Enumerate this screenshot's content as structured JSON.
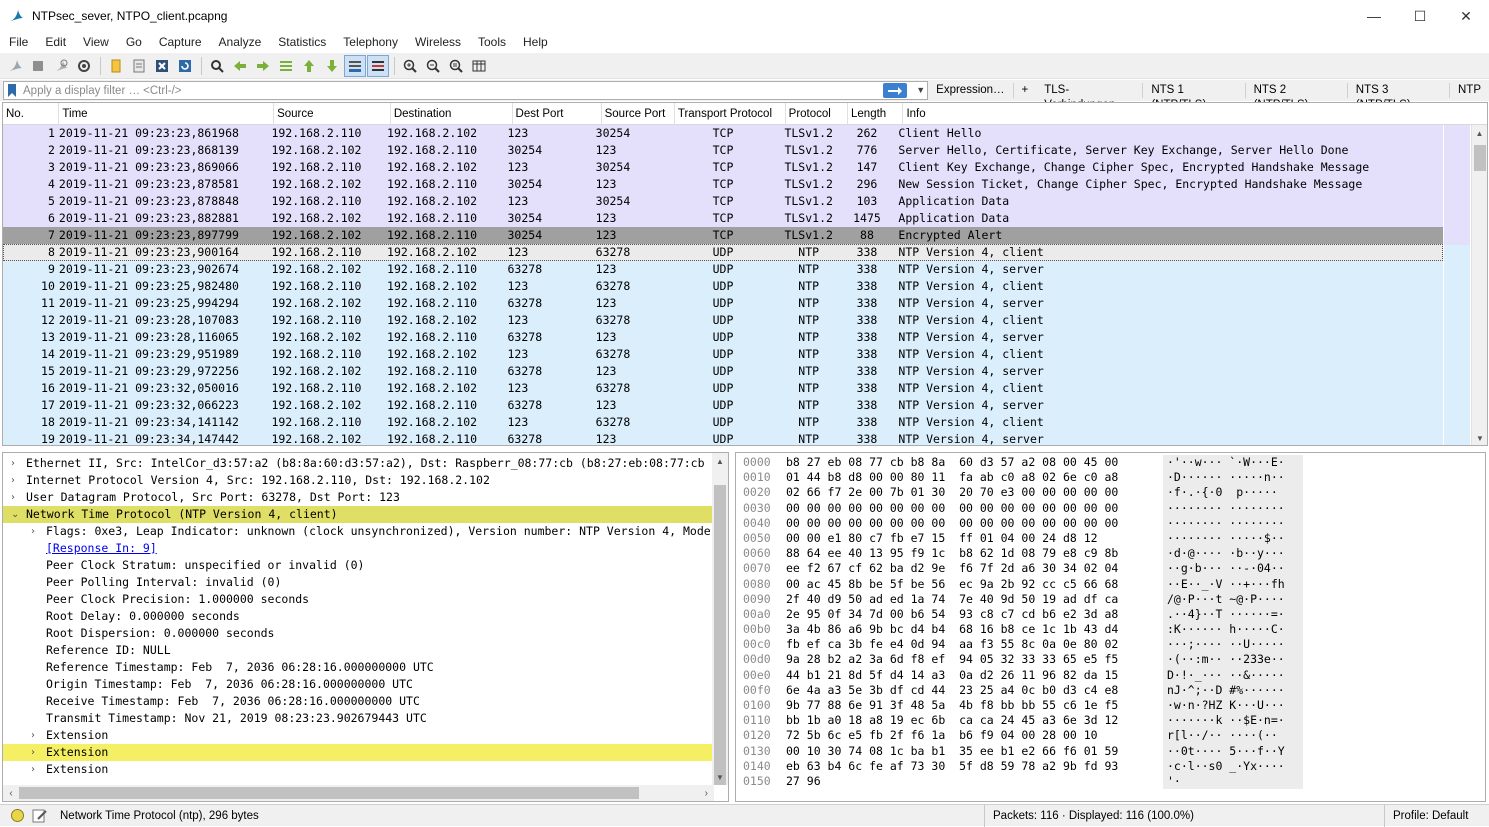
{
  "window": {
    "title": "NTPsec_sever, NTPO_client.pcapng"
  },
  "menu": [
    "File",
    "Edit",
    "View",
    "Go",
    "Capture",
    "Analyze",
    "Statistics",
    "Telephony",
    "Wireless",
    "Tools",
    "Help"
  ],
  "filter": {
    "placeholder": "Apply a display filter … <Ctrl-/>",
    "buttons": [
      "Expression…",
      "+",
      "TLS-Verbindungen",
      "NTS 1 (NTP/TLS)",
      "NTS 2 (NTP/TLS)",
      "NTS 3 (NTP/TLS)",
      "NTP"
    ]
  },
  "columns": [
    "No.",
    "Time",
    "Source",
    "Destination",
    "Dest Port",
    "Source Port",
    "Transport Protocol",
    "Protocol",
    "Length",
    "Info"
  ],
  "packets": [
    {
      "no": "1",
      "time": "2019-11-21 09:23:23,861968",
      "src": "192.168.2.110",
      "dst": "192.168.2.102",
      "dport": "123",
      "sport": "30254",
      "tp": "TCP",
      "proto": "TLSv1.2",
      "len": "262",
      "info": "Client Hello",
      "kind": "tls"
    },
    {
      "no": "2",
      "time": "2019-11-21 09:23:23,868139",
      "src": "192.168.2.102",
      "dst": "192.168.2.110",
      "dport": "30254",
      "sport": "123",
      "tp": "TCP",
      "proto": "TLSv1.2",
      "len": "776",
      "info": "Server Hello, Certificate, Server Key Exchange, Server Hello Done",
      "kind": "tls"
    },
    {
      "no": "3",
      "time": "2019-11-21 09:23:23,869066",
      "src": "192.168.2.110",
      "dst": "192.168.2.102",
      "dport": "123",
      "sport": "30254",
      "tp": "TCP",
      "proto": "TLSv1.2",
      "len": "147",
      "info": "Client Key Exchange, Change Cipher Spec, Encrypted Handshake Message",
      "kind": "tls"
    },
    {
      "no": "4",
      "time": "2019-11-21 09:23:23,878581",
      "src": "192.168.2.102",
      "dst": "192.168.2.110",
      "dport": "30254",
      "sport": "123",
      "tp": "TCP",
      "proto": "TLSv1.2",
      "len": "296",
      "info": "New Session Ticket, Change Cipher Spec, Encrypted Handshake Message",
      "kind": "tls"
    },
    {
      "no": "5",
      "time": "2019-11-21 09:23:23,878848",
      "src": "192.168.2.110",
      "dst": "192.168.2.102",
      "dport": "123",
      "sport": "30254",
      "tp": "TCP",
      "proto": "TLSv1.2",
      "len": "103",
      "info": "Application Data",
      "kind": "tls"
    },
    {
      "no": "6",
      "time": "2019-11-21 09:23:23,882881",
      "src": "192.168.2.102",
      "dst": "192.168.2.110",
      "dport": "30254",
      "sport": "123",
      "tp": "TCP",
      "proto": "TLSv1.2",
      "len": "1475",
      "info": "Application Data",
      "kind": "tls"
    },
    {
      "no": "7",
      "time": "2019-11-21 09:23:23,897799",
      "src": "192.168.2.102",
      "dst": "192.168.2.110",
      "dport": "30254",
      "sport": "123",
      "tp": "TCP",
      "proto": "TLSv1.2",
      "len": "88",
      "info": "Encrypted Alert",
      "kind": "dark"
    },
    {
      "no": "8",
      "time": "2019-11-21 09:23:23,900164",
      "src": "192.168.2.110",
      "dst": "192.168.2.102",
      "dport": "123",
      "sport": "63278",
      "tp": "UDP",
      "proto": "NTP",
      "len": "338",
      "info": "NTP Version 4, client",
      "kind": "cur"
    },
    {
      "no": "9",
      "time": "2019-11-21 09:23:23,902674",
      "src": "192.168.2.102",
      "dst": "192.168.2.110",
      "dport": "63278",
      "sport": "123",
      "tp": "UDP",
      "proto": "NTP",
      "len": "338",
      "info": "NTP Version 4, server",
      "kind": "ntp"
    },
    {
      "no": "10",
      "time": "2019-11-21 09:23:25,982480",
      "src": "192.168.2.110",
      "dst": "192.168.2.102",
      "dport": "123",
      "sport": "63278",
      "tp": "UDP",
      "proto": "NTP",
      "len": "338",
      "info": "NTP Version 4, client",
      "kind": "ntp"
    },
    {
      "no": "11",
      "time": "2019-11-21 09:23:25,994294",
      "src": "192.168.2.102",
      "dst": "192.168.2.110",
      "dport": "63278",
      "sport": "123",
      "tp": "UDP",
      "proto": "NTP",
      "len": "338",
      "info": "NTP Version 4, server",
      "kind": "ntp"
    },
    {
      "no": "12",
      "time": "2019-11-21 09:23:28,107083",
      "src": "192.168.2.110",
      "dst": "192.168.2.102",
      "dport": "123",
      "sport": "63278",
      "tp": "UDP",
      "proto": "NTP",
      "len": "338",
      "info": "NTP Version 4, client",
      "kind": "ntp"
    },
    {
      "no": "13",
      "time": "2019-11-21 09:23:28,116065",
      "src": "192.168.2.102",
      "dst": "192.168.2.110",
      "dport": "63278",
      "sport": "123",
      "tp": "UDP",
      "proto": "NTP",
      "len": "338",
      "info": "NTP Version 4, server",
      "kind": "ntp"
    },
    {
      "no": "14",
      "time": "2019-11-21 09:23:29,951989",
      "src": "192.168.2.110",
      "dst": "192.168.2.102",
      "dport": "123",
      "sport": "63278",
      "tp": "UDP",
      "proto": "NTP",
      "len": "338",
      "info": "NTP Version 4, client",
      "kind": "ntp"
    },
    {
      "no": "15",
      "time": "2019-11-21 09:23:29,972256",
      "src": "192.168.2.102",
      "dst": "192.168.2.110",
      "dport": "63278",
      "sport": "123",
      "tp": "UDP",
      "proto": "NTP",
      "len": "338",
      "info": "NTP Version 4, server",
      "kind": "ntp"
    },
    {
      "no": "16",
      "time": "2019-11-21 09:23:32,050016",
      "src": "192.168.2.110",
      "dst": "192.168.2.102",
      "dport": "123",
      "sport": "63278",
      "tp": "UDP",
      "proto": "NTP",
      "len": "338",
      "info": "NTP Version 4, client",
      "kind": "ntp"
    },
    {
      "no": "17",
      "time": "2019-11-21 09:23:32,066223",
      "src": "192.168.2.102",
      "dst": "192.168.2.110",
      "dport": "63278",
      "sport": "123",
      "tp": "UDP",
      "proto": "NTP",
      "len": "338",
      "info": "NTP Version 4, server",
      "kind": "ntp"
    },
    {
      "no": "18",
      "time": "2019-11-21 09:23:34,141142",
      "src": "192.168.2.110",
      "dst": "192.168.2.102",
      "dport": "123",
      "sport": "63278",
      "tp": "UDP",
      "proto": "NTP",
      "len": "338",
      "info": "NTP Version 4, client",
      "kind": "ntp"
    },
    {
      "no": "19",
      "time": "2019-11-21 09:23:34,147442",
      "src": "192.168.2.102",
      "dst": "192.168.2.110",
      "dport": "63278",
      "sport": "123",
      "tp": "UDP",
      "proto": "NTP",
      "len": "338",
      "info": "NTP Version 4, server",
      "kind": "ntp"
    }
  ],
  "details": [
    {
      "text": "Ethernet II, Src: IntelCor_d3:57:a2 (b8:8a:60:d3:57:a2), Dst: Raspberr_08:77:cb (b8:27:eb:08:77:cb",
      "arrow": "›",
      "indent": 0,
      "style": ""
    },
    {
      "text": "Internet Protocol Version 4, Src: 192.168.2.110, Dst: 192.168.2.102",
      "arrow": "›",
      "indent": 0,
      "style": ""
    },
    {
      "text": "User Datagram Protocol, Src Port: 63278, Dst Port: 123",
      "arrow": "›",
      "indent": 0,
      "style": ""
    },
    {
      "text": "Network Time Protocol (NTP Version 4, client)",
      "arrow": "⌄",
      "indent": 0,
      "style": "hl"
    },
    {
      "text": "Flags: 0xe3, Leap Indicator: unknown (clock unsynchronized), Version number: NTP Version 4, Mode",
      "arrow": "›",
      "indent": 1,
      "style": ""
    },
    {
      "text": "[Response In: 9]",
      "arrow": "",
      "indent": 1,
      "style": "link"
    },
    {
      "text": "Peer Clock Stratum: unspecified or invalid (0)",
      "arrow": "",
      "indent": 1,
      "style": ""
    },
    {
      "text": "Peer Polling Interval: invalid (0)",
      "arrow": "",
      "indent": 1,
      "style": ""
    },
    {
      "text": "Peer Clock Precision: 1.000000 seconds",
      "arrow": "",
      "indent": 1,
      "style": ""
    },
    {
      "text": "Root Delay: 0.000000 seconds",
      "arrow": "",
      "indent": 1,
      "style": ""
    },
    {
      "text": "Root Dispersion: 0.000000 seconds",
      "arrow": "",
      "indent": 1,
      "style": ""
    },
    {
      "text": "Reference ID: NULL",
      "arrow": "",
      "indent": 1,
      "style": ""
    },
    {
      "text": "Reference Timestamp: Feb  7, 2036 06:28:16.000000000 UTC",
      "arrow": "",
      "indent": 1,
      "style": ""
    },
    {
      "text": "Origin Timestamp: Feb  7, 2036 06:28:16.000000000 UTC",
      "arrow": "",
      "indent": 1,
      "style": ""
    },
    {
      "text": "Receive Timestamp: Feb  7, 2036 06:28:16.000000000 UTC",
      "arrow": "",
      "indent": 1,
      "style": ""
    },
    {
      "text": "Transmit Timestamp: Nov 21, 2019 08:23:23.902679443 UTC",
      "arrow": "",
      "indent": 1,
      "style": ""
    },
    {
      "text": "Extension",
      "arrow": "›",
      "indent": 1,
      "style": ""
    },
    {
      "text": "Extension",
      "arrow": "›",
      "indent": 1,
      "style": "hl2"
    },
    {
      "text": "Extension",
      "arrow": "›",
      "indent": 1,
      "style": ""
    }
  ],
  "hex": [
    {
      "off": "0000",
      "bytes": "b8 27 eb 08 77 cb b8 8a  60 d3 57 a2 08 00 45 00",
      "ascii": "·'··w··· `·W···E·"
    },
    {
      "off": "0010",
      "bytes": "01 44 b8 d8 00 00 80 11  fa ab c0 a8 02 6e c0 a8",
      "ascii": "·D······ ·····n··"
    },
    {
      "off": "0020",
      "bytes": "02 66 f7 2e 00 7b 01 30  20 70 e3 00 00 00 00 00",
      "ascii": "·f·.·{·0  p·····"
    },
    {
      "off": "0030",
      "bytes": "00 00 00 00 00 00 00 00  00 00 00 00 00 00 00 00",
      "ascii": "········ ········"
    },
    {
      "off": "0040",
      "bytes": "00 00 00 00 00 00 00 00  00 00 00 00 00 00 00 00",
      "ascii": "········ ········"
    },
    {
      "off": "0050",
      "bytes": "00 00 e1 80 c7 fb e7 15  ff 01 04 00 24 d8 12",
      "ascii": "········ ·····$··"
    },
    {
      "off": "0060",
      "bytes": "88 64 ee 40 13 95 f9 1c  b8 62 1d 08 79 e8 c9 8b",
      "ascii": "·d·@···· ·b··y···"
    },
    {
      "off": "0070",
      "bytes": "ee f2 67 cf 62 ba d2 9e  f6 7f 2d a6 30 34 02 04",
      "ascii": "··g·b··· ··-·04··"
    },
    {
      "off": "0080",
      "bytes": "00 ac 45 8b be 5f be 56  ec 9a 2b 92 cc c5 66 68",
      "ascii": "··E··_·V ··+···fh"
    },
    {
      "off": "0090",
      "bytes": "2f 40 d9 50 ad ed 1a 74  7e 40 9d 50 19 ad df ca",
      "ascii": "/@·P···t ~@·P····"
    },
    {
      "off": "00a0",
      "bytes": "2e 95 0f 34 7d 00 b6 54  93 c8 c7 cd b6 e2 3d a8",
      "ascii": ".··4}··T ······=·"
    },
    {
      "off": "00b0",
      "bytes": "3a 4b 86 a6 9b bc d4 b4  68 16 b8 ce 1c 1b 43 d4",
      "ascii": ":K······ h·····C·"
    },
    {
      "off": "00c0",
      "bytes": "fb ef ca 3b fe e4 0d 94  aa f3 55 8c 0a 0e 80 02",
      "ascii": "···;···· ··U·····"
    },
    {
      "off": "00d0",
      "bytes": "9a 28 b2 a2 3a 6d f8 ef  94 05 32 33 33 65 e5 f5",
      "ascii": "·(··:m·· ··233e··"
    },
    {
      "off": "00e0",
      "bytes": "44 b1 21 8d 5f d4 14 a3  0a d2 26 11 96 82 da 15",
      "ascii": "D·!·_··· ··&·····"
    },
    {
      "off": "00f0",
      "bytes": "6e 4a a3 5e 3b df cd 44  23 25 a4 0c b0 d3 c4 e8",
      "ascii": "nJ·^;··D #%······"
    },
    {
      "off": "0100",
      "bytes": "9b 77 88 6e 91 3f 48 5a  4b f8 bb bb 55 c6 1e f5",
      "ascii": "·w·n·?HZ K···U···"
    },
    {
      "off": "0110",
      "bytes": "bb 1b a0 18 a8 19 ec 6b  ca ca 24 45 a3 6e 3d 12",
      "ascii": "·······k ··$E·n=·"
    },
    {
      "off": "0120",
      "bytes": "72 5b 6c e5 fb 2f f6 1a  b6 f9 04 00 28 00 10",
      "ascii": "r[l··/·· ····(··"
    },
    {
      "off": "0130",
      "bytes": "00 10 30 74 08 1c ba b1  35 ee b1 e2 66 f6 01 59",
      "ascii": "··0t···· 5···f··Y"
    },
    {
      "off": "0140",
      "bytes": "eb 63 b4 6c fe af 73 30  5f d8 59 78 a2 9b fd 93",
      "ascii": "·c·l··s0 _·Yx····"
    },
    {
      "off": "0150",
      "bytes": "27 96",
      "ascii": "'·"
    }
  ],
  "status": {
    "text": "Network Time Protocol (ntp), 296 bytes",
    "packets": "Packets: 116 · Displayed: 116 (100.0%)",
    "profile": "Profile: Default"
  },
  "colors": {
    "tls_row": "#e4e0fb",
    "ntp_row": "#daeefc",
    "selected_dark": "#a0a0a0",
    "highlight": "#dfdf66"
  }
}
